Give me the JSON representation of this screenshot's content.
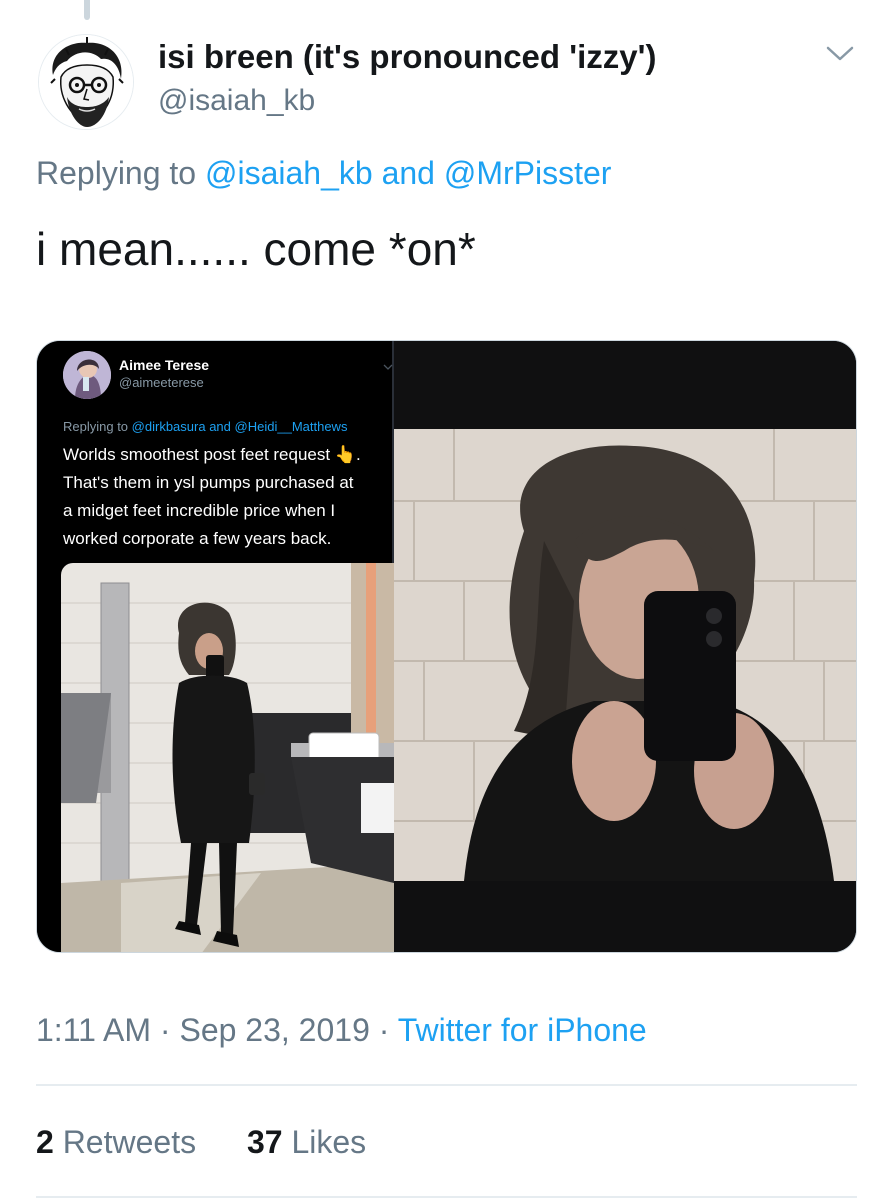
{
  "tweet": {
    "display_name": "isi breen (it's pronounced 'izzy')",
    "handle": "@isaiah_kb",
    "replying_prefix": "Replying to",
    "replying_mentions": [
      "@isaiah_kb",
      "@MrPisster"
    ],
    "replying_conjunction": "and",
    "text": "i mean...... come *on*",
    "time": "1:11 AM",
    "date": "Sep 23, 2019",
    "source": "Twitter for iPhone",
    "separator": "·",
    "retweets_count": "2",
    "retweets_label": "Retweets",
    "likes_count": "37",
    "likes_label": "Likes"
  },
  "embedded_tweet": {
    "display_name": "Aimee Terese",
    "handle": "@aimeeterese",
    "replying_prefix": "Replying to",
    "replying_mentions": [
      "@dirkbasura",
      "@Heidi__Matthews"
    ],
    "replying_conjunction": "and",
    "lines": [
      "Worlds smoothest post feet request 👆.",
      "That's them in ysl pumps purchased at",
      "a midget feet incredible price when I",
      "worked corporate a few years back."
    ]
  },
  "icons": {
    "caret": "chevron-down-icon",
    "avatar": "sketch-portrait-avatar"
  },
  "colors": {
    "link": "#1da1f2",
    "secondary_text": "#657786",
    "primary_text": "#14171a",
    "divider": "#e6ecf0"
  }
}
